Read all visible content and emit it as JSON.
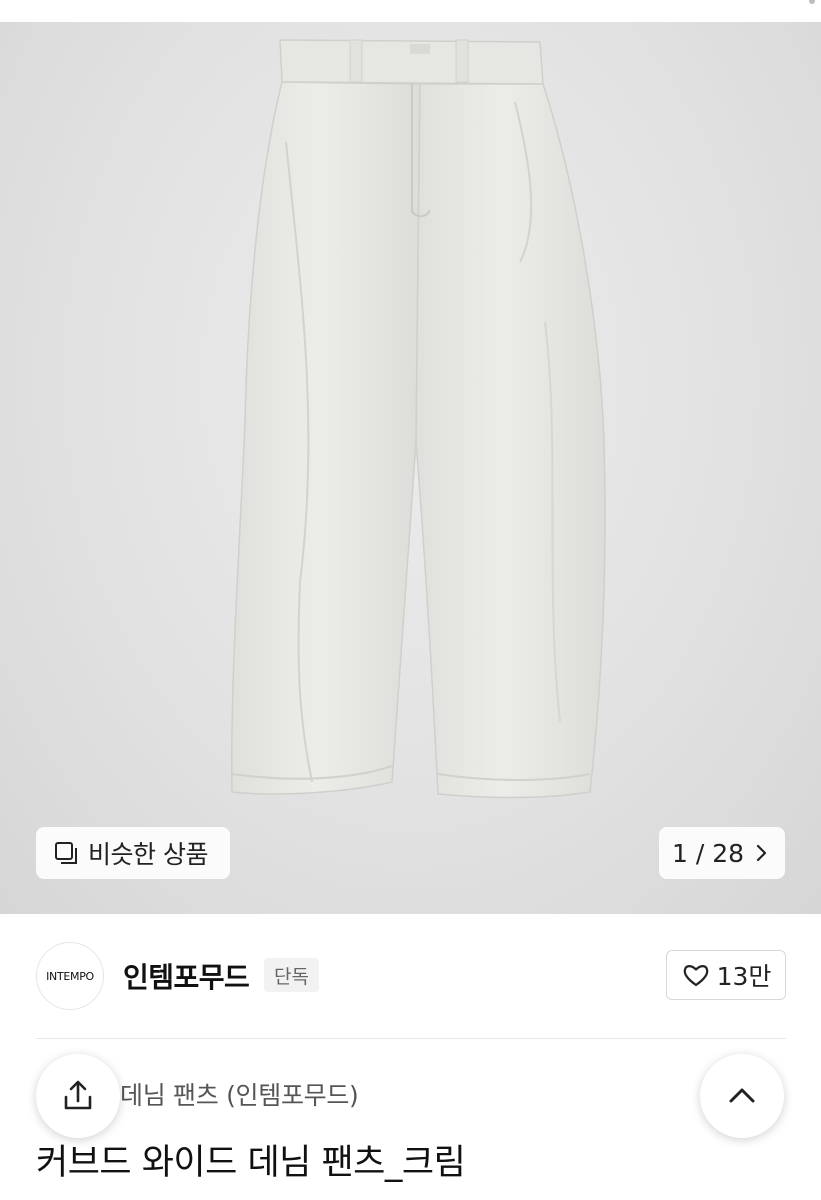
{
  "gallery": {
    "similar_label": "비슷한 상품",
    "counter": "1 / 28",
    "image_icon": "copy-icon",
    "next_icon": "chevron-right-icon"
  },
  "brand": {
    "logo_text": "INTEMPO",
    "name": "인템포무드",
    "badge": "단독",
    "likes": "13만",
    "like_icon": "heart-icon"
  },
  "product": {
    "category": "데님 팬츠 (인템포무드)",
    "title": "커브드 와이드 데님 팬츠_크림"
  },
  "actions": {
    "share_icon": "share-icon",
    "top_icon": "chevron-up-icon"
  },
  "colors": {
    "background": "#ffffff",
    "gallery_bg": "#e4e4e4",
    "pants": "#e9eae6",
    "text": "#111111"
  }
}
